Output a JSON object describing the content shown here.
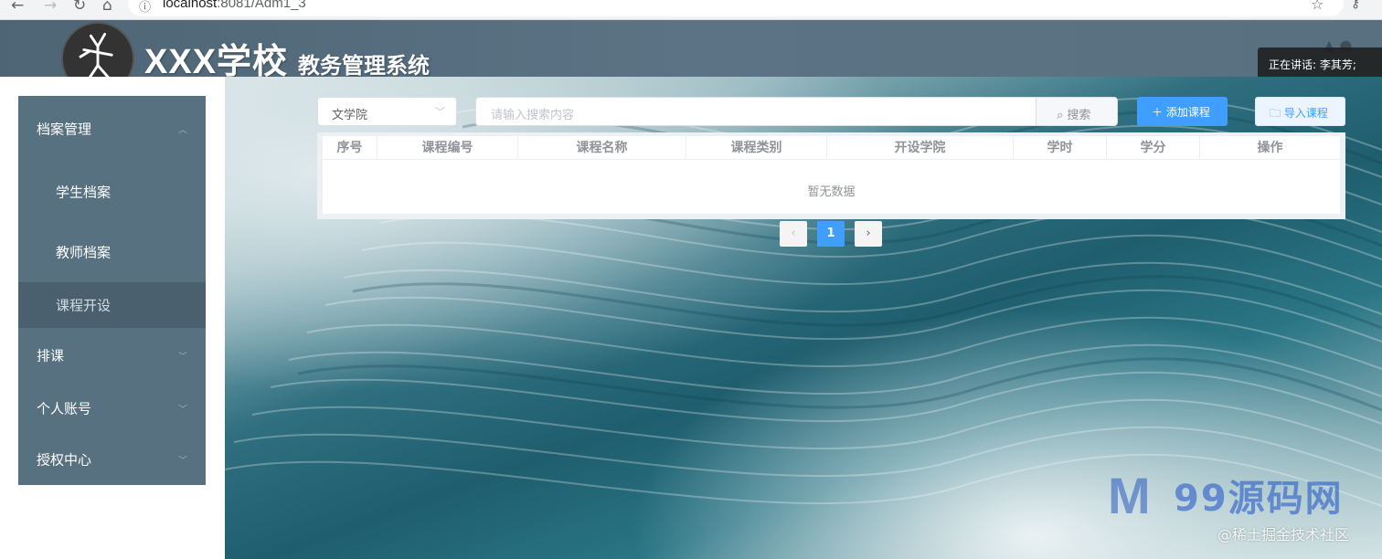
{
  "browser": {
    "url_host": "localhost",
    "url_rest": ":8081/Adm1_3"
  },
  "header": {
    "title_main": "XXX学校",
    "title_sub": "教务管理系统",
    "speaking": "正在讲话: 李其芳;"
  },
  "sidebar": {
    "groups": [
      {
        "label": "档案管理",
        "expanded": true
      },
      {
        "label": "排课"
      },
      {
        "label": "个人账号"
      },
      {
        "label": "授权中心"
      }
    ],
    "sub_items": [
      {
        "label": "学生档案"
      },
      {
        "label": "教师档案"
      },
      {
        "label": "课程开设",
        "active": true
      }
    ]
  },
  "toolbar": {
    "college_select": "文学院",
    "search_placeholder": "请输入搜索内容",
    "search_label": "搜索",
    "add_label": "添加课程",
    "import_label": "导入课程"
  },
  "table": {
    "columns": [
      "序号",
      "课程编号",
      "课程名称",
      "课程类别",
      "开设学院",
      "学时",
      "学分",
      "操作"
    ],
    "empty_text": "暂无数据"
  },
  "pagination": {
    "current": "1",
    "prev_icon": "chevron-left-icon",
    "next_icon": "chevron-right-icon"
  },
  "watermark": {
    "logo_text": "99源码网",
    "juejin": "@稀土掘金技术社区"
  },
  "colors": {
    "accent": "#409eff",
    "sidebar": "#587180",
    "header": "#56707f"
  }
}
